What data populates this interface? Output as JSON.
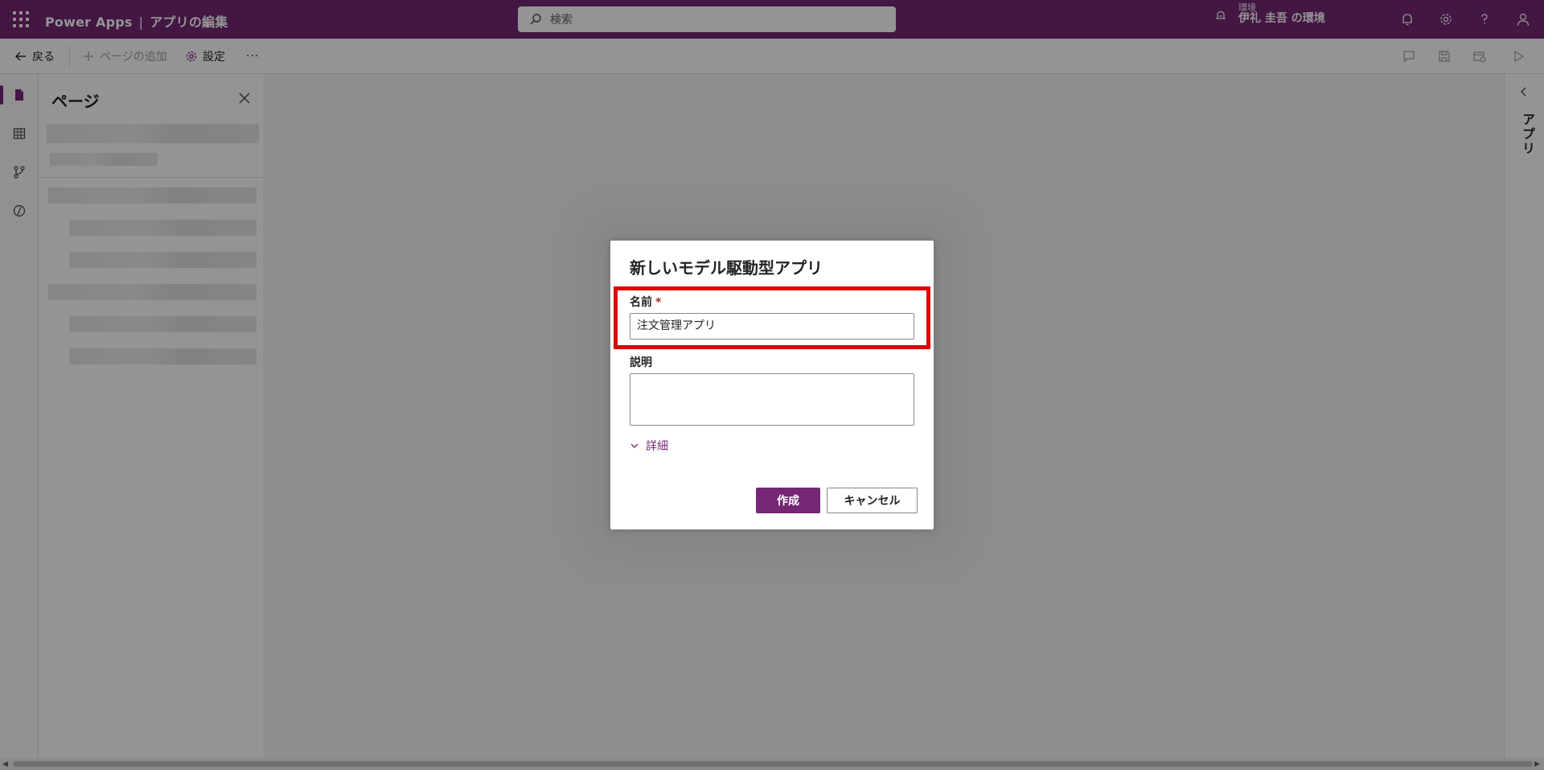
{
  "header": {
    "app_name": "Power Apps",
    "separator": "|",
    "page_title": "アプリの編集",
    "search_placeholder": "検索",
    "environment_label": "環境",
    "environment_name": "伊礼 圭吾 の環境"
  },
  "toolbar": {
    "back_label": "戻る",
    "add_page_label": "ページの追加",
    "settings_label": "設定",
    "more_label": "···"
  },
  "pages_panel": {
    "title": "ページ"
  },
  "right_pane": {
    "label": "アプリ"
  },
  "dialog": {
    "title": "新しいモデル駆動型アプリ",
    "name_label": "名前",
    "required_marker": "*",
    "name_value": "注文管理アプリ",
    "description_label": "説明",
    "description_value": "",
    "details_label": "詳細",
    "create_button": "作成",
    "cancel_button": "キャンセル",
    "highlight_color": "#e00000"
  },
  "colors": {
    "brand": "#742774"
  }
}
